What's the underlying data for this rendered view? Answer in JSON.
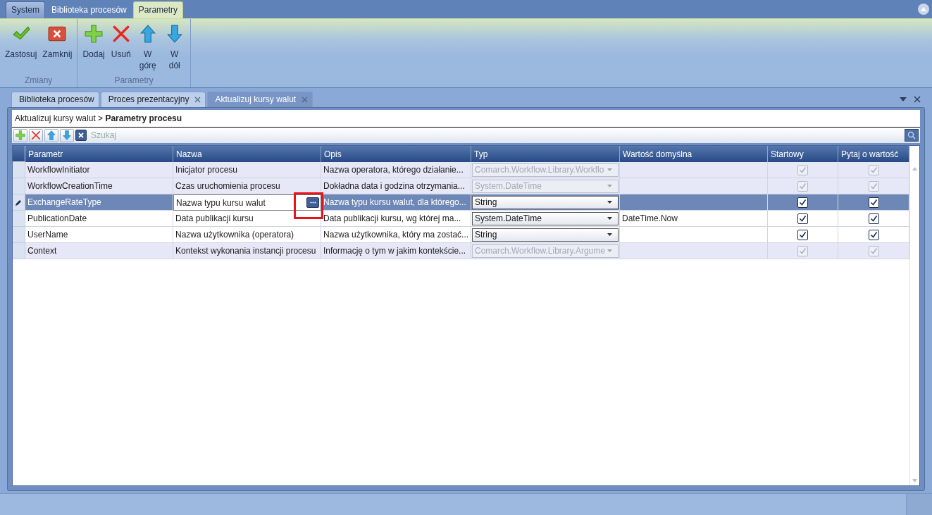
{
  "ribbon_tabs": [
    {
      "label": "System",
      "selected": false,
      "kind": "app"
    },
    {
      "label": "Biblioteka procesów",
      "selected": false,
      "kind": "tab"
    },
    {
      "label": "Parametry",
      "selected": true,
      "kind": "tab"
    }
  ],
  "ribbon_groups": [
    {
      "label": "Zmiany",
      "buttons": [
        {
          "label": "Zastosuj",
          "kind": "apply"
        },
        {
          "label": "Zamknij",
          "kind": "close"
        }
      ]
    },
    {
      "label": "Parametry",
      "buttons": [
        {
          "label": "Dodaj",
          "kind": "add"
        },
        {
          "label": "Usuń",
          "kind": "remove"
        },
        {
          "label": "W górę",
          "kind": "up"
        },
        {
          "label": "W dół",
          "kind": "down"
        }
      ]
    }
  ],
  "document_tabs": [
    {
      "label": "Biblioteka procesów",
      "selected": false,
      "closable": false
    },
    {
      "label": "Proces prezentacyjny",
      "selected": false,
      "closable": true
    },
    {
      "label": "Aktualizuj kursy walut",
      "selected": true,
      "closable": true
    }
  ],
  "breadcrumb": {
    "path": "Aktualizuj kursy walut >",
    "current": "Parametry procesu"
  },
  "grid_toolbar": {
    "buttons": [
      {
        "kind": "add"
      },
      {
        "kind": "remove"
      },
      {
        "kind": "up"
      },
      {
        "kind": "down"
      }
    ],
    "search": {
      "placeholder": "Szukaj"
    }
  },
  "table": {
    "columns": [
      "Parametr",
      "Nazwa",
      "Opis",
      "Typ",
      "Wartość domyślna",
      "Startowy",
      "Pytaj o wartość"
    ],
    "rows": [
      {
        "parametr": "WorkflowInitiator",
        "nazwa": "Inicjator procesu",
        "opis": "Nazwa operatora, którego działanie...",
        "typ": "Comarch.Workflow.Library.Workflo",
        "wartosc": "",
        "startowy": true,
        "pytaj": true,
        "disabled": true,
        "selected": false,
        "editing": false
      },
      {
        "parametr": "WorkflowCreationTime",
        "nazwa": "Czas uruchomienia procesu",
        "opis": "Dokładna data i godzina otrzymania...",
        "typ": "System.DateTime",
        "wartosc": "",
        "startowy": true,
        "pytaj": true,
        "disabled": true,
        "selected": false,
        "editing": false
      },
      {
        "parametr": "ExchangeRateType",
        "nazwa": "Nazwa typu kursu walut",
        "opis": "Nazwa typu kursu walut, dla którego...",
        "typ": "String",
        "wartosc": "",
        "startowy": true,
        "pytaj": true,
        "disabled": false,
        "selected": true,
        "editing": true
      },
      {
        "parametr": "PublicationDate",
        "nazwa": "Data publikacji kursu",
        "opis": "Data publikacji kursu, wg której ma...",
        "typ": "System.DateTime",
        "wartosc": "DateTime.Now",
        "startowy": true,
        "pytaj": true,
        "disabled": false,
        "selected": false,
        "editing": false
      },
      {
        "parametr": "UserName",
        "nazwa": "Nazwa użytkownika (operatora)",
        "opis": "Nazwa użytkownika, który ma zostać...",
        "typ": "String",
        "wartosc": "",
        "startowy": true,
        "pytaj": true,
        "disabled": false,
        "selected": false,
        "editing": false
      },
      {
        "parametr": "Context",
        "nazwa": "Kontekst wykonania instancji procesu",
        "opis": "Informację o tym w jakim kontekście...",
        "typ": "Comarch.Workflow.Library.Argume",
        "wartosc": "",
        "startowy": true,
        "pytaj": true,
        "disabled": true,
        "selected": false,
        "editing": false
      }
    ]
  },
  "annotation": {
    "highlight": true
  }
}
